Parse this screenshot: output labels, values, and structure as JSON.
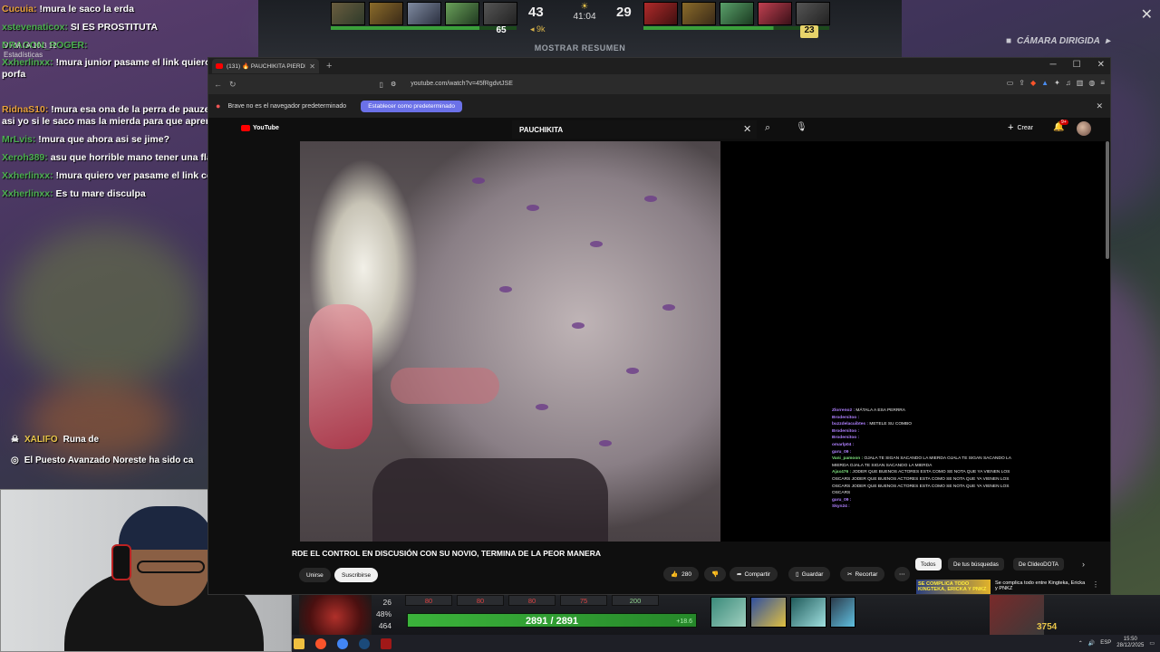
{
  "colors": {
    "brave_accent": "#fb542b",
    "set_default_button": "#6b71e8",
    "youtube_red": "#ff0000",
    "health_green": "#3bb33b",
    "radiant_score": "#eeeeee"
  },
  "game": {
    "radiant_score": "43",
    "dire_score": "29",
    "clock": "41:04",
    "net_worth_lead": "9k",
    "radiant_level": "65",
    "dire_level": "23",
    "summary_button": "MOSTRAR RESUMEN",
    "camera_mode": "CÁMARA DIRIGIDA",
    "stats_overlay": "V / M / A  10   3   12",
    "stats_label": "Estadísticas"
  },
  "chat": {
    "messages": [
      {
        "user": "Cucuia:",
        "text": "!mura le saco la erda",
        "color": "orange"
      },
      {
        "user": "xstevenaticox:",
        "text": "SI ES PROSTITUTA",
        "color": "green"
      },
      {
        "user": "DRAGON_ROGER:",
        "text": "",
        "color": "green"
      },
      {
        "user": "Xxherlinxx:",
        "text": "!mura junior pasame el link quiero ver ese video porfa",
        "color": "green"
      },
      {
        "user": "RidnaS10:",
        "text": "!mura esa ona de la perra de pauzepita si me habla asi yo si le saco mas la mierda para que aprenda a esa puta",
        "color": "orange"
      },
      {
        "user": "MrLvis:",
        "text": "!mura que ahora asi se jime?",
        "color": "green"
      },
      {
        "user": "Xeroh389:",
        "text": "asu que horrible mano tener una flaca asi",
        "color": "green"
      },
      {
        "user": "Xxherlinxx:",
        "text": "!mura quiero ver pasame el link concha tu madre",
        "color": "green"
      },
      {
        "user": "Xxherlinxx:",
        "text": "Es tu mare disculpa",
        "color": "green"
      }
    ],
    "event_rune_player": "XALIFO",
    "event_rune_text": "Runa de",
    "event_outpost": "El Puesto Avanzado Noreste ha sido ca"
  },
  "browser": {
    "tab_title": "(131) 🔥 PAUCHIKITA PIERDE EL",
    "url": "youtube.com/watch?v=45fRgdvtJSE",
    "infobar_text": "Brave no es el navegador predeterminado",
    "set_default_label": "Establecer como predeterminado"
  },
  "youtube": {
    "logo_text": "YouTube",
    "search_value": "PAUCHIKITA",
    "create_label": "Crear",
    "notifications_count": "9+",
    "video_title": "RDE EL CONTROL EN DISCUSIÓN CON SU NOVIO, TERMINA DE LA PEOR MANERA",
    "join_label": "Unirse",
    "subscribe_label": "Suscribirse",
    "like_count": "280",
    "share_label": "Compartir",
    "save_label": "Guardar",
    "clip_label": "Recortar",
    "chips": [
      "Todos",
      "De tus búsquedas",
      "De ClideoDOTA"
    ],
    "rec_thumb_text": "SE COMPLICA TODO KINGTEKA, ERICKA Y PNKZ",
    "rec_title": "Se complica todo entre Kingteka, Ericka y PNKZ",
    "stream_chat": [
      {
        "user": "Zlorreno2 :",
        "text": "MÁTALA A ESA PERRRA"
      },
      {
        "user": "Brodersitoo :",
        "text": ""
      },
      {
        "user": "buzzdelacuibtes :",
        "text": "METELE SU COMBO"
      },
      {
        "user": "Brodersitoo :",
        "text": ""
      },
      {
        "user": "Brodersitoo :",
        "text": ""
      },
      {
        "user": "omarlp04 :",
        "text": ""
      },
      {
        "user": "garu_09 :",
        "text": ""
      },
      {
        "user": "Vani_pamoon :",
        "text": "OJALA TE SIGAN SACANDO LA MIERDA   OJALA TE SIGAN SACANDO LA MIERDA   OJALA TE SIGAN SACANDO LA MIERDA"
      },
      {
        "user": "Ajax476 :",
        "text": "JODER QUE BUENOS ACTORES ESTA COMO SE NOTA QUE YA VIENEN LOS OSCARS JODER QUE BUENOS ACTORES ESTA COMO SE NOTA QUE YA VIENEN LOS OSCARS JODER QUE BUENOS ACTORES ESTA COMO SE NOTA QUE YA VIENEN LOS OSCARS"
      },
      {
        "user": "garu_09 :",
        "text": ""
      },
      {
        "user": "Skyn24 :",
        "text": ""
      }
    ]
  },
  "hud": {
    "stat_1": "26",
    "stat_2": "48%",
    "stat_3": "464",
    "abilities": [
      "80",
      "80",
      "80",
      "75",
      "200"
    ],
    "health": "2891 / 2891",
    "health_regen": "+18.6",
    "gold": "3754"
  },
  "taskbar": {
    "language": "ESP",
    "time": "15:50",
    "date": "28/12/2025"
  }
}
